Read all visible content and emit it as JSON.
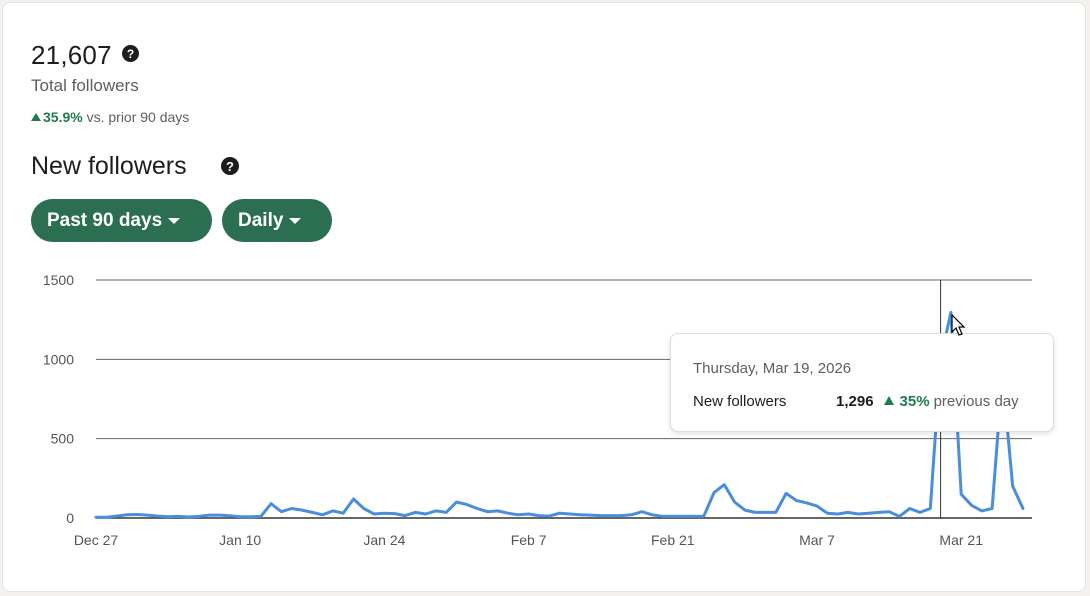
{
  "summary": {
    "total_followers": "21,607",
    "total_label": "Total followers",
    "change_value": "35.9%",
    "change_text": "vs. prior 90 days"
  },
  "section": {
    "title": "New followers"
  },
  "filters": {
    "range_label": "Past 90 days",
    "granularity_label": "Daily"
  },
  "tooltip": {
    "date": "Thursday, Mar 19, 2026",
    "metric_label": "New followers",
    "metric_value": "1,296",
    "change_value": "35%",
    "change_text": "previous day"
  },
  "colors": {
    "line": "#4a8ddc",
    "accent_green": "#2b6e52",
    "positive": "#1f7a4f"
  },
  "chart_data": {
    "type": "line",
    "x_start": "Dec 27",
    "x_tick_labels": [
      "Dec 27",
      "Jan 10",
      "Jan 24",
      "Feb 7",
      "Feb 21",
      "Mar 7",
      "Mar 21"
    ],
    "y_tick_labels": [
      "1500",
      "1000",
      "500",
      "0"
    ],
    "ylim": [
      0,
      1500
    ],
    "grid": true,
    "highlight_index": 82,
    "series": [
      {
        "values": [
          5,
          5,
          12,
          20,
          22,
          18,
          12,
          8,
          10,
          6,
          10,
          18,
          18,
          14,
          8,
          8,
          10,
          90,
          40,
          60,
          50,
          35,
          20,
          45,
          30,
          120,
          60,
          25,
          30,
          28,
          15,
          35,
          25,
          45,
          35,
          100,
          85,
          60,
          40,
          45,
          30,
          20,
          25,
          15,
          12,
          30,
          25,
          20,
          18,
          15,
          15,
          15,
          20,
          40,
          20,
          10,
          10,
          10,
          10,
          10,
          160,
          210,
          100,
          50,
          35,
          35,
          35,
          155,
          110,
          95,
          75,
          30,
          25,
          35,
          25,
          30,
          35,
          40,
          10,
          60,
          35,
          60,
          1000,
          1296,
          150,
          80,
          45,
          60,
          900,
          200,
          60
        ]
      }
    ]
  }
}
